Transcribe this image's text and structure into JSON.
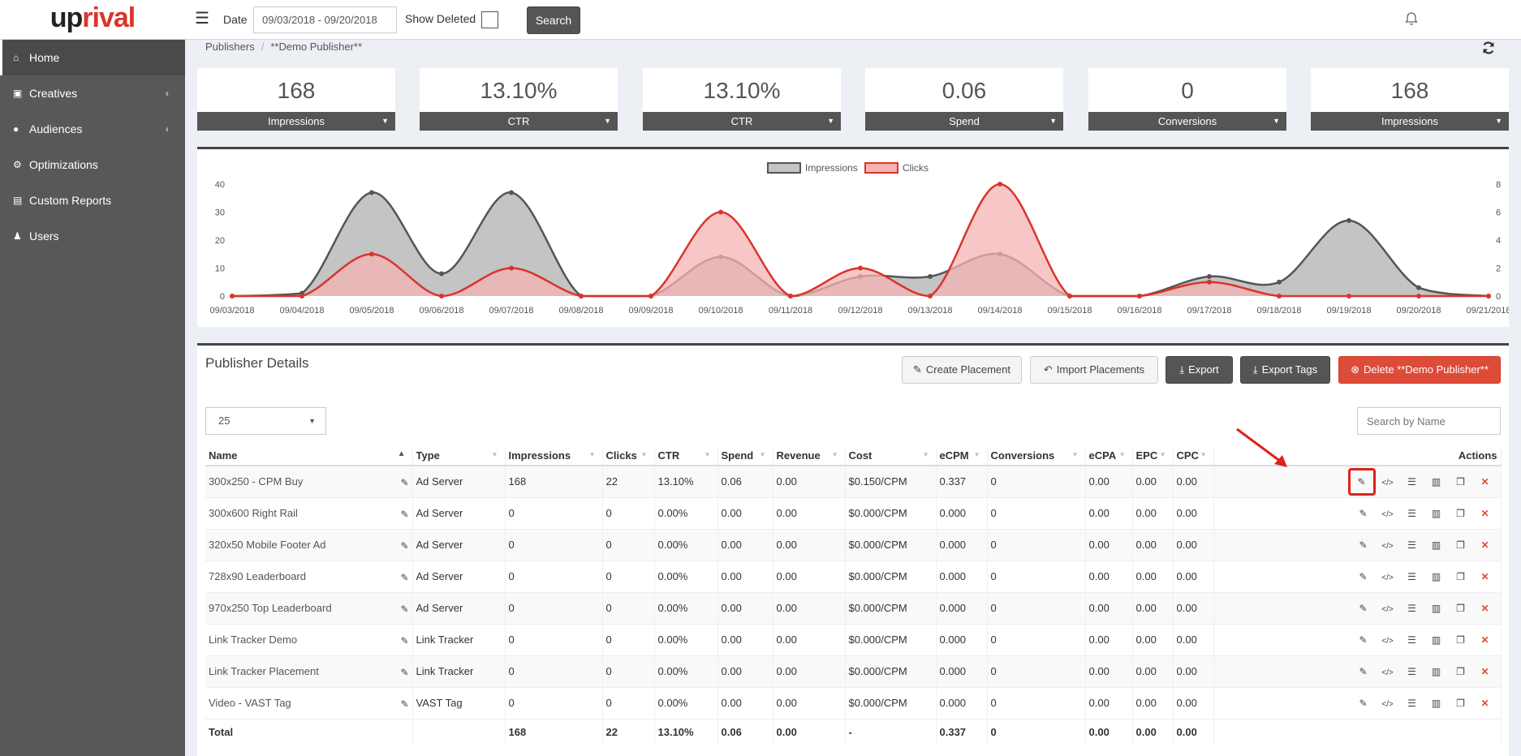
{
  "app": {
    "logo_part1": "up",
    "logo_part2": "rival"
  },
  "header": {
    "date_label": "Date",
    "date_value": "09/03/2018 - 09/20/2018",
    "show_deleted_label": "Show Deleted",
    "search_label": "Search"
  },
  "sidebar": {
    "items": [
      {
        "label": "Home",
        "icon": "home-icon"
      },
      {
        "label": "Creatives",
        "icon": "image-icon"
      },
      {
        "label": "Audiences",
        "icon": "users-icon"
      },
      {
        "label": "Optimizations",
        "icon": "gears-icon"
      },
      {
        "label": "Custom Reports",
        "icon": "document-icon"
      },
      {
        "label": "Users",
        "icon": "user-icon"
      }
    ]
  },
  "breadcrumb": {
    "parent": "Publishers",
    "sep": "/",
    "current": "**Demo Publisher**"
  },
  "stats": [
    {
      "value": "168",
      "label": "Impressions"
    },
    {
      "value": "13.10%",
      "label": "CTR"
    },
    {
      "value": "13.10%",
      "label": "CTR"
    },
    {
      "value": "0.06",
      "label": "Spend"
    },
    {
      "value": "0",
      "label": "Conversions"
    },
    {
      "value": "168",
      "label": "Impressions"
    }
  ],
  "chart_data": {
    "type": "area",
    "x": [
      "09/03/2018",
      "09/04/2018",
      "09/05/2018",
      "09/06/2018",
      "09/07/2018",
      "09/08/2018",
      "09/09/2018",
      "09/10/2018",
      "09/11/2018",
      "09/12/2018",
      "09/13/2018",
      "09/14/2018",
      "09/15/2018",
      "09/16/2018",
      "09/17/2018",
      "09/18/2018",
      "09/19/2018",
      "09/20/2018",
      "09/21/2018"
    ],
    "series": [
      {
        "name": "Impressions",
        "axis": "left",
        "color": "#555555",
        "fill": "#c4c4c4",
        "values": [
          0,
          1,
          37,
          8,
          37,
          0,
          0,
          14,
          0,
          7,
          7,
          15,
          0,
          0,
          7,
          5,
          27,
          3,
          0
        ]
      },
      {
        "name": "Clicks",
        "axis": "right",
        "color": "#d9342b",
        "fill": "#f4b3b3",
        "values": [
          0,
          0,
          3,
          0,
          2,
          0,
          0,
          6,
          0,
          2,
          0,
          8,
          0,
          0,
          1,
          0,
          0,
          0,
          0
        ]
      }
    ],
    "y_left": {
      "ticks": [
        "0",
        "10",
        "20",
        "30",
        "40"
      ],
      "range": [
        0,
        40
      ]
    },
    "y_right": {
      "ticks": [
        "0",
        "2",
        "4",
        "6",
        "8"
      ],
      "range": [
        0,
        8
      ]
    },
    "legend_position": "top-center",
    "grid": false
  },
  "panel": {
    "title": "Publisher Details",
    "btn_create": "Create Placement",
    "btn_import": "Import Placements",
    "btn_export": "Export",
    "btn_export_tags": "Export Tags",
    "btn_delete": "Delete **Demo Publisher**",
    "page_length": "25",
    "search_placeholder": "Search by Name"
  },
  "table": {
    "columns": [
      "Name",
      "Type",
      "Impressions",
      "Clicks",
      "CTR",
      "Spend",
      "Revenue",
      "Cost",
      "eCPM",
      "Conversions",
      "eCPA",
      "EPC",
      "CPC",
      "Actions"
    ],
    "rows": [
      [
        "300x250 - CPM Buy",
        "Ad Server",
        "168",
        "22",
        "13.10%",
        "0.06",
        "0.00",
        "$0.150/CPM",
        "0.337",
        "0",
        "0.00",
        "0.00",
        "0.00"
      ],
      [
        "300x600 Right Rail",
        "Ad Server",
        "0",
        "0",
        "0.00%",
        "0.00",
        "0.00",
        "$0.000/CPM",
        "0.000",
        "0",
        "0.00",
        "0.00",
        "0.00"
      ],
      [
        "320x50 Mobile Footer Ad",
        "Ad Server",
        "0",
        "0",
        "0.00%",
        "0.00",
        "0.00",
        "$0.000/CPM",
        "0.000",
        "0",
        "0.00",
        "0.00",
        "0.00"
      ],
      [
        "728x90 Leaderboard",
        "Ad Server",
        "0",
        "0",
        "0.00%",
        "0.00",
        "0.00",
        "$0.000/CPM",
        "0.000",
        "0",
        "0.00",
        "0.00",
        "0.00"
      ],
      [
        "970x250 Top Leaderboard",
        "Ad Server",
        "0",
        "0",
        "0.00%",
        "0.00",
        "0.00",
        "$0.000/CPM",
        "0.000",
        "0",
        "0.00",
        "0.00",
        "0.00"
      ],
      [
        "Link Tracker Demo",
        "Link Tracker",
        "0",
        "0",
        "0.00%",
        "0.00",
        "0.00",
        "$0.000/CPM",
        "0.000",
        "0",
        "0.00",
        "0.00",
        "0.00"
      ],
      [
        "Link Tracker Placement",
        "Link Tracker",
        "0",
        "0",
        "0.00%",
        "0.00",
        "0.00",
        "$0.000/CPM",
        "0.000",
        "0",
        "0.00",
        "0.00",
        "0.00"
      ],
      [
        "Video - VAST Tag",
        "VAST Tag",
        "0",
        "0",
        "0.00%",
        "0.00",
        "0.00",
        "$0.000/CPM",
        "0.000",
        "0",
        "0.00",
        "0.00",
        "0.00"
      ]
    ],
    "total": [
      "Total",
      "",
      "168",
      "22",
      "13.10%",
      "0.06",
      "0.00",
      "-",
      "0.337",
      "0",
      "0.00",
      "0.00",
      "0.00"
    ],
    "row_actions": [
      "edit-icon",
      "code-icon",
      "list-icon",
      "bar-chart-icon",
      "copy-icon",
      "delete-icon"
    ]
  },
  "colors": {
    "accent_red": "#dd4b39",
    "sidebar": "#585858",
    "dark_button": "#555555",
    "annotation": "#e0201a"
  }
}
